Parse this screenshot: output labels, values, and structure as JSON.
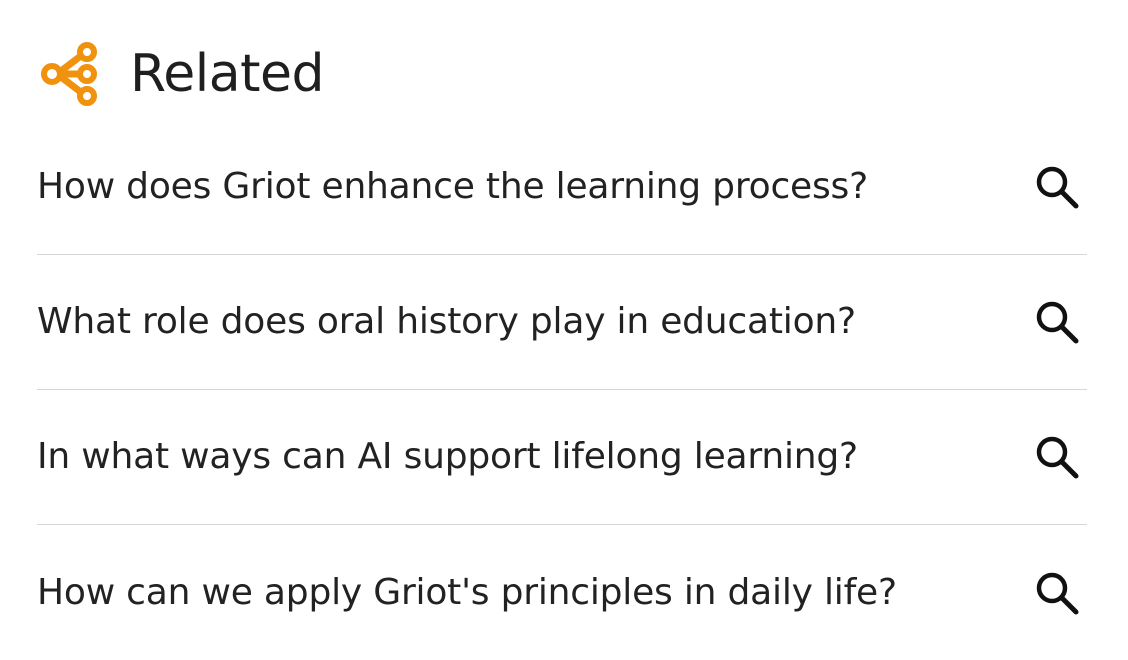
{
  "section": {
    "title": "Related",
    "icon": "share-nodes-icon",
    "accent_color": "#f0920e"
  },
  "related": {
    "items": [
      {
        "label": "How does Griot enhance the learning process?",
        "icon": "search-icon"
      },
      {
        "label": "What role does oral history play in education?",
        "icon": "search-icon"
      },
      {
        "label": "In what ways can AI support lifelong learning?",
        "icon": "search-icon"
      },
      {
        "label": "How can we apply Griot's principles in daily life?",
        "icon": "search-icon"
      }
    ]
  }
}
